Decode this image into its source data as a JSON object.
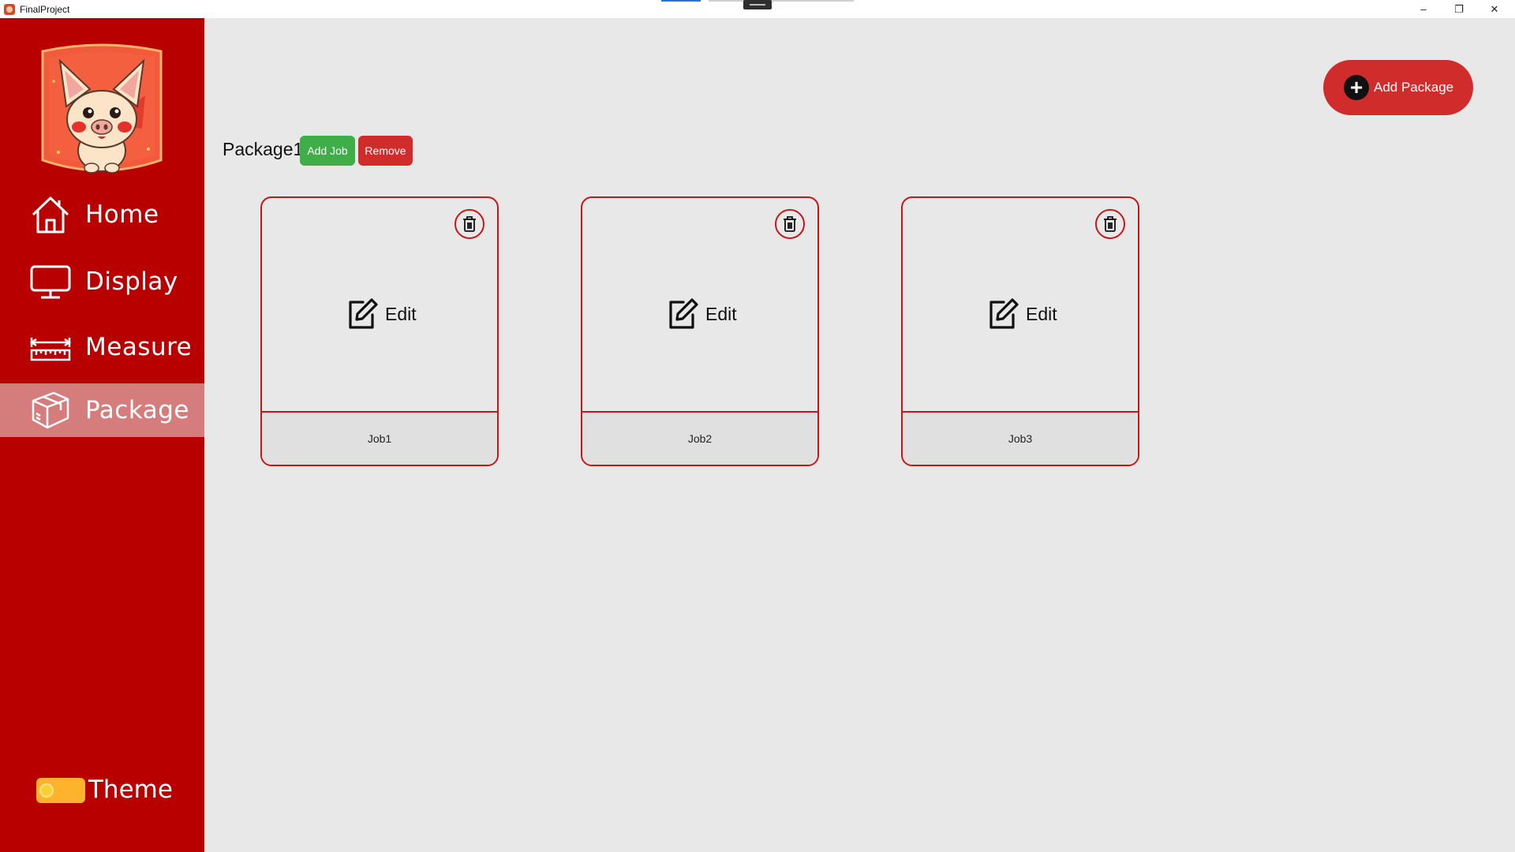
{
  "window": {
    "title": "FinalProject",
    "minimize_glyph": "–",
    "maximize_glyph": "❐",
    "close_glyph": "✕"
  },
  "sidebar": {
    "logo_icon": "pig-logo",
    "items": [
      {
        "label": "Home",
        "icon": "home-icon"
      },
      {
        "label": "Display",
        "icon": "monitor-icon"
      },
      {
        "label": "Measure",
        "icon": "ruler-icon"
      },
      {
        "label": "Package",
        "icon": "box-icon",
        "active": true
      }
    ],
    "theme_label": "Theme"
  },
  "main": {
    "add_package_label": "Add Package",
    "add_package_icon": "plus-circle-icon",
    "package": {
      "name": "Package1",
      "add_job_label": "Add Job",
      "remove_label": "Remove",
      "jobs": [
        {
          "name": "Job1",
          "edit_label": "Edit"
        },
        {
          "name": "Job2",
          "edit_label": "Edit"
        },
        {
          "name": "Job3",
          "edit_label": "Edit"
        }
      ]
    }
  },
  "colors": {
    "sidebar": "#b90000",
    "active_nav": "#d57d7d",
    "accent_red": "#d12c2c",
    "accent_green": "#3fae48",
    "theme_toggle": "#ffb22b",
    "background": "#e8e8e8"
  }
}
